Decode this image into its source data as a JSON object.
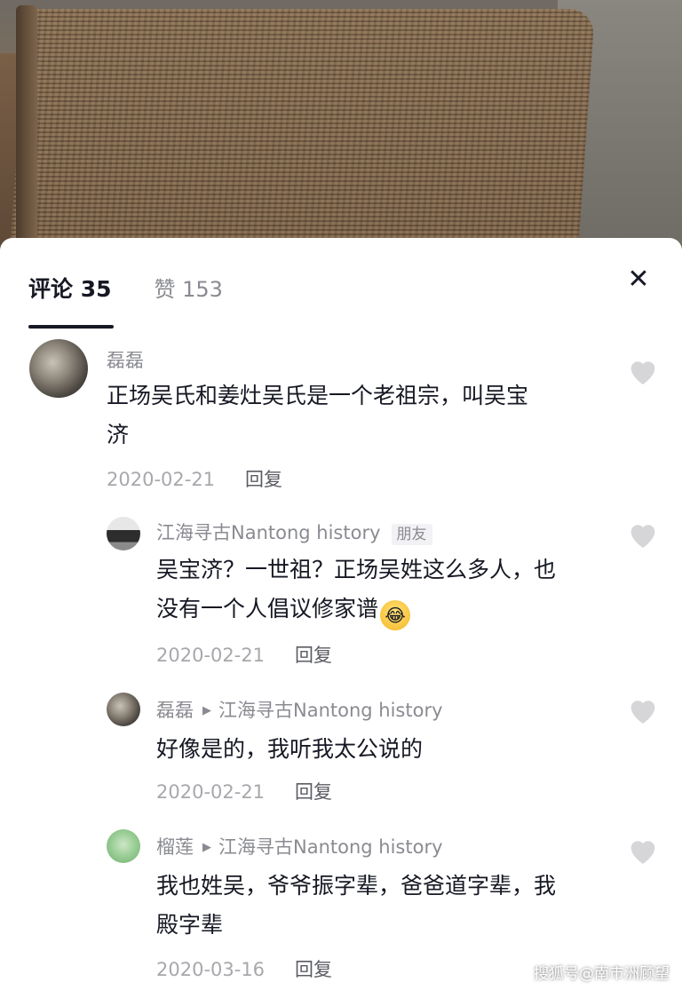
{
  "header": {
    "comments_tab": "评论 35",
    "likes_tab": "赞 153",
    "close_icon": "close-icon"
  },
  "comments": [
    {
      "user": "磊磊",
      "avatar": "stone-avatar",
      "text_line1": "正场吴氏和姜灶吴氏是一个老祖宗，叫吴宝",
      "text_line2": "济",
      "date": "2020-02-21",
      "reply": "回复"
    },
    {
      "user": "江海寻古Nantong history",
      "tag": "朋友",
      "avatar": "house-avatar",
      "text_line1": "吴宝济？一世祖？正场吴姓这么多人，也",
      "text_line2": "没有一个人倡议修家谱",
      "emoji": "laughing-crying-emoji",
      "date": "2020-02-21",
      "reply": "回复"
    },
    {
      "user": "磊磊",
      "reply_to": "江海寻古Nantong history",
      "avatar": "stone-avatar",
      "text_line1": "好像是的，我听我太公说的",
      "date": "2020-02-21",
      "reply": "回复"
    },
    {
      "user": "榴莲",
      "reply_to": "江海寻古Nantong history",
      "avatar": "green-avatar",
      "text_line1": "我也姓吴，爷爷振字辈，爸爸道字辈，我",
      "text_line2": "殿字辈",
      "date": "2020-03-16",
      "reply": "回复"
    }
  ],
  "watermark": "搜狐号@南市洲顾望",
  "colors": {
    "text": "#161823",
    "muted": "#8a8b91",
    "heart": "#d6d6d9"
  }
}
